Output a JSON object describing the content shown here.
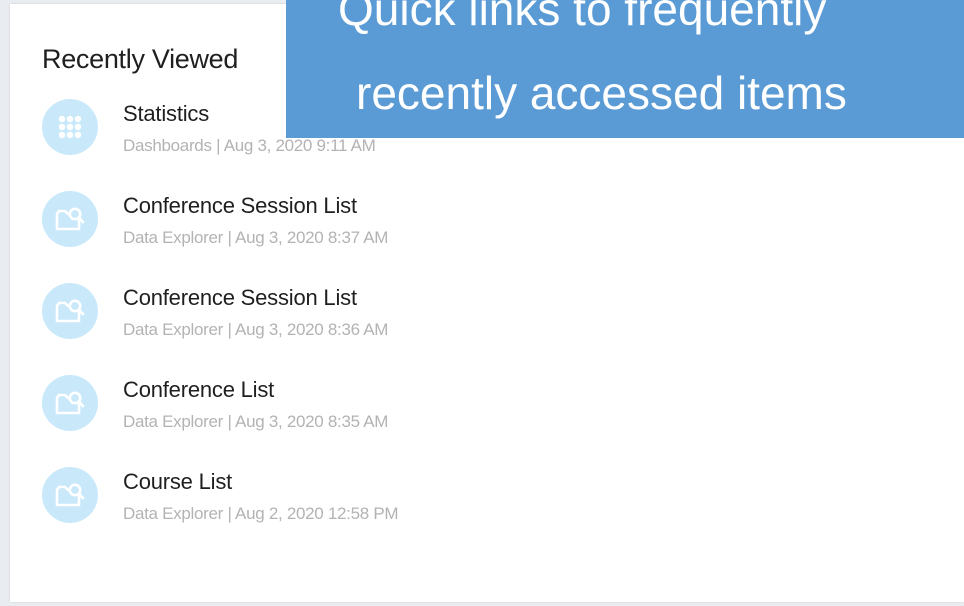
{
  "panel": {
    "title": "Recently Viewed",
    "items": [
      {
        "name": "Statistics",
        "meta": "Dashboards | Aug 3, 2020 9:11 AM",
        "icon": "dashboard-grid-icon"
      },
      {
        "name": "Conference Session List",
        "meta": "Data Explorer | Aug 3, 2020 8:37 AM",
        "icon": "data-explorer-icon"
      },
      {
        "name": "Conference Session List",
        "meta": "Data Explorer | Aug 3, 2020 8:36 AM",
        "icon": "data-explorer-icon"
      },
      {
        "name": "Conference List",
        "meta": "Data Explorer | Aug 3, 2020 8:35 AM",
        "icon": "data-explorer-icon"
      },
      {
        "name": "Course List",
        "meta": "Data Explorer | Aug 2, 2020 12:58 PM",
        "icon": "data-explorer-icon"
      }
    ]
  },
  "callout": {
    "line1": "Quick links to frequently",
    "line2": "recently accessed items"
  },
  "colors": {
    "icon_bg": "#c9e9fb",
    "callout_bg": "#5b9bd5",
    "meta_text": "#b3b3b3"
  }
}
